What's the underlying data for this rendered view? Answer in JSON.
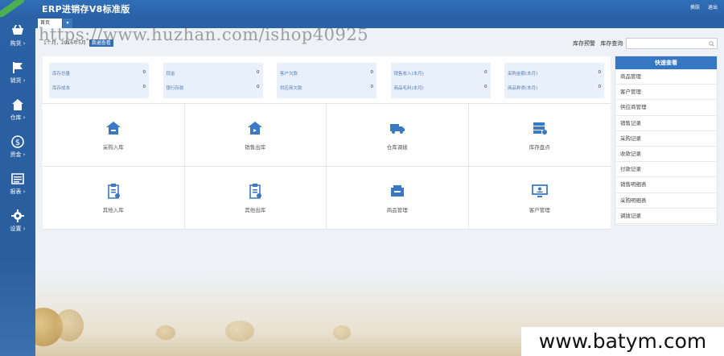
{
  "app": {
    "title": "ERP进销存V8标准版",
    "ribbon": ""
  },
  "top_links": [
    "换肤",
    "退出"
  ],
  "sidebar": {
    "items": [
      {
        "label": "购货",
        "icon": "basket-icon"
      },
      {
        "label": "销货",
        "icon": "flag-icon"
      },
      {
        "label": "仓库",
        "icon": "house-icon"
      },
      {
        "label": "资金",
        "icon": "dollar-icon"
      },
      {
        "label": "报表",
        "icon": "report-icon"
      },
      {
        "label": "设置",
        "icon": "gear-icon"
      }
    ]
  },
  "tabs": {
    "home": "首页",
    "more": "▾"
  },
  "watermark": {
    "top": "https://www.huzhan.com/ishop40925",
    "bottom": "www.batym.com"
  },
  "breadcrumb": {
    "text": "1个月，2016年5月",
    "tag": "数据查看"
  },
  "stock": {
    "warning": "库存预警",
    "query": "库存查询"
  },
  "stats": [
    {
      "a_label": "库存总量",
      "a_val": "0",
      "b_label": "库存成本",
      "b_val": "0"
    },
    {
      "a_label": "现金",
      "a_val": "0",
      "b_label": "银行存款",
      "b_val": "0"
    },
    {
      "a_label": "客户欠款",
      "a_val": "0",
      "b_label": "供应商欠款",
      "b_val": "0"
    },
    {
      "a_label": "销售收入(本月)",
      "a_val": "0",
      "b_label": "商品毛利(本月)",
      "b_val": "0"
    },
    {
      "a_label": "采购金额(本月)",
      "a_val": "0",
      "b_label": "商品种类(本月)",
      "b_val": "0"
    }
  ],
  "tiles": [
    {
      "label": "采购入库",
      "icon": "purchase-in-icon"
    },
    {
      "label": "销售出库",
      "icon": "sales-out-icon"
    },
    {
      "label": "仓库调拨",
      "icon": "truck-icon"
    },
    {
      "label": "库存盘点",
      "icon": "inventory-icon"
    },
    {
      "label": "其他入库",
      "icon": "clipboard-in-icon"
    },
    {
      "label": "其他出库",
      "icon": "clipboard-out-icon"
    },
    {
      "label": "商品管理",
      "icon": "product-icon"
    },
    {
      "label": "客户管理",
      "icon": "monitor-icon"
    }
  ],
  "quick": {
    "title": "快速查看",
    "items": [
      "商品管理",
      "客户管理",
      "供应商管理",
      "销售记录",
      "采购记录",
      "收款记录",
      "付款记录",
      "销售明细表",
      "采购明细表",
      "调拨记录"
    ]
  }
}
